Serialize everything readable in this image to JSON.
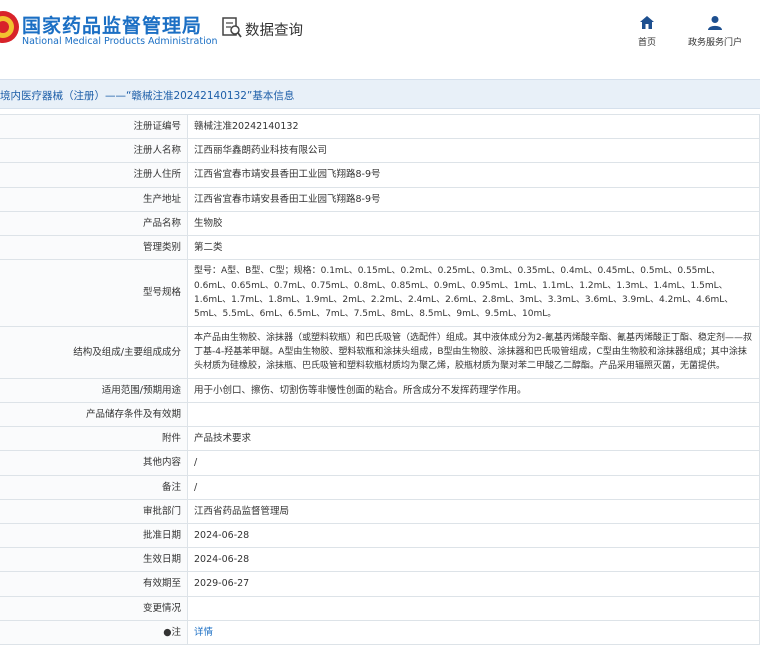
{
  "header": {
    "site_title": "国家药品监督管理局",
    "site_subtitle": "National Medical Products Administration",
    "query_title": "数据查询",
    "nav": [
      {
        "label": "首页",
        "icon": "home-icon"
      },
      {
        "label": "政务服务门户",
        "icon": "user-icon"
      }
    ],
    "colors": {
      "brand": "#1b6fc4",
      "bar": "#e8f0f8"
    }
  },
  "subbar": {
    "text": "境内医疗器械（注册）——“赣械注准20242140132”基本信息"
  },
  "rows": [
    {
      "label": "注册证编号",
      "value": "赣械注准20242140132"
    },
    {
      "label": "注册人名称",
      "value": "江西丽华鑫朗药业科技有限公司"
    },
    {
      "label": "注册人住所",
      "value": "江西省宜春市靖安县香田工业园飞翔路8-9号"
    },
    {
      "label": "生产地址",
      "value": "江西省宜春市靖安县香田工业园飞翔路8-9号"
    },
    {
      "label": "产品名称",
      "value": "生物胶"
    },
    {
      "label": "管理类别",
      "value": "第二类"
    },
    {
      "label": "型号规格",
      "value": "型号：A型、B型、C型；规格：0.1mL、0.15mL、0.2mL、0.25mL、0.3mL、0.35mL、0.4mL、0.45mL、0.5mL、0.55mL、0.6mL、0.65mL、0.7mL、0.75mL、0.8mL、0.85mL、0.9mL、0.95mL、1mL、1.1mL、1.2mL、1.3mL、1.4mL、1.5mL、1.6mL、1.7mL、1.8mL、1.9mL、2mL、2.2mL、2.4mL、2.6mL、2.8mL、3mL、3.3mL、3.6mL、3.9mL、4.2mL、4.6mL、5mL、5.5mL、6mL、6.5mL、7mL、7.5mL、8mL、8.5mL、9mL、9.5mL、10mL。"
    },
    {
      "label": "结构及组成/主要组成成分",
      "value": "本产品由生物胶、涂抹器（或塑料软瓶）和巴氏吸管（选配件）组成。其中液体成分为2-氰基丙烯酸辛酯、氰基丙烯酸正丁酯、稳定剂——叔丁基-4-羟基苯甲醚。A型由生物胶、塑料软瓶和涂抹头组成，B型由生物胶、涂抹器和巴氏吸管组成，C型由生物胶和涂抹器组成；其中涂抹头材质为硅橡胶，涂抹瓶、巴氏吸管和塑料软瓶材质均为聚乙烯，胶瓶材质为聚对苯二甲酸乙二醇酯。产品采用辐照灭菌，无菌提供。"
    },
    {
      "label": "适用范围/预期用途",
      "value": "用于小创口、擦伤、切割伤等非慢性创面的粘合。所含成分不发挥药理学作用。"
    },
    {
      "label": "产品储存条件及有效期",
      "value": ""
    },
    {
      "label": "附件",
      "value": "产品技术要求"
    },
    {
      "label": "其他内容",
      "value": "/"
    },
    {
      "label": "备注",
      "value": "/"
    },
    {
      "label": "审批部门",
      "value": "江西省药品监督管理局"
    },
    {
      "label": "批准日期",
      "value": "2024-06-28"
    },
    {
      "label": "生效日期",
      "value": "2024-06-28"
    },
    {
      "label": "有效期至",
      "value": "2029-06-27"
    },
    {
      "label": "变更情况",
      "value": ""
    },
    {
      "label": "●注",
      "value": "详情"
    }
  ]
}
